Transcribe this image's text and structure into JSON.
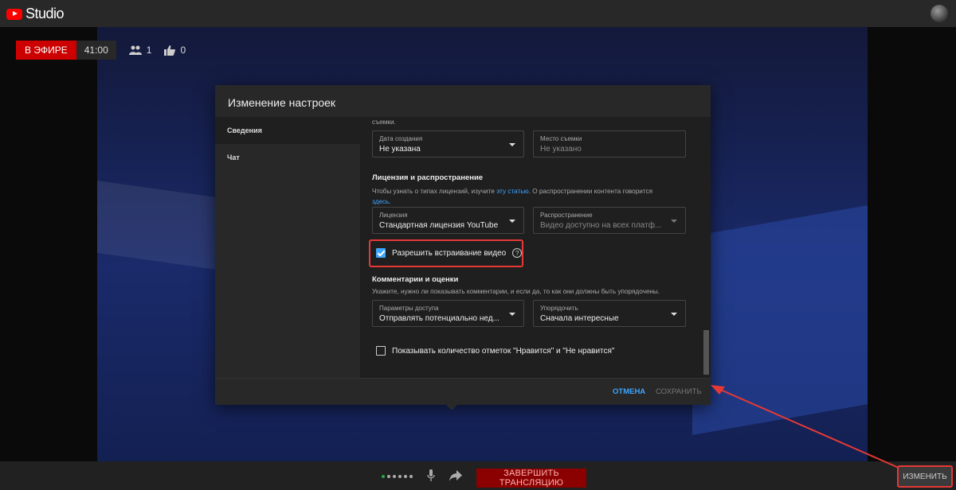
{
  "app": {
    "logo_text": "Studio"
  },
  "live": {
    "badge": "В ЭФИРЕ",
    "time": "41:00",
    "viewers": "1",
    "likes": "0"
  },
  "dialog": {
    "title": "Изменение настроек",
    "nav": [
      {
        "label": "Сведения"
      },
      {
        "label": "Чат"
      }
    ],
    "top_text": "съемки.",
    "date_field": {
      "label": "Дата создания",
      "value": "Не указана"
    },
    "location_field": {
      "label": "Место съемки",
      "placeholder": "Не указано"
    },
    "license_section": {
      "title": "Лицензия и распространение",
      "text_before": "Чтобы узнать о типах лицензий, изучите ",
      "link1": "эту статью",
      "text_middle": ". О распространении контента говорится",
      "link2": "здесь",
      "text_end": "."
    },
    "license_field": {
      "label": "Лицензия",
      "value": "Стандартная лицензия YouTube"
    },
    "distribution_field": {
      "label": "Распространение",
      "value": "Видео доступно на всех платф..."
    },
    "embed_checkbox": {
      "label": "Разрешить встраивание видео",
      "help": "?"
    },
    "comments_section": {
      "title": "Комментарии и оценки",
      "text": "Укажите, нужно ли показывать комментарии, и если да, то как они должны быть упорядочены."
    },
    "access_field": {
      "label": "Параметры доступа",
      "value": "Отправлять потенциально нед..."
    },
    "sort_field": {
      "label": "Упорядочить",
      "value": "Сначала интересные"
    },
    "likes_checkbox": {
      "label": "Показывать количество отметок \"Нравится\" и \"Не нравится\""
    },
    "cancel": "ОТМЕНА",
    "save": "СОХРАНИТЬ"
  },
  "bottom": {
    "end_stream": "ЗАВЕРШИТЬ ТРАНСЛЯЦИЮ",
    "edit": "ИЗМЕНИТЬ"
  },
  "colors": {
    "accent": "#3ea6ff",
    "live": "#cc0000",
    "highlight": "#e53935"
  }
}
